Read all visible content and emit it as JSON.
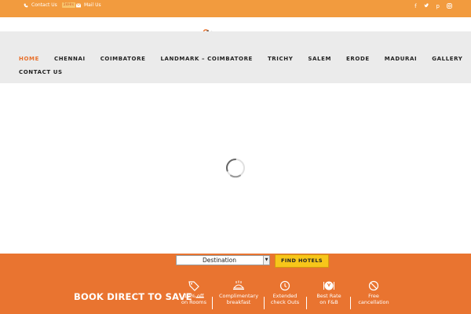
{
  "topbar": {
    "contact_label": "Contact Us",
    "contact_badge": "24Hrs",
    "mail_label": "Mail Us",
    "social_icons": [
      "facebook-icon",
      "twitter-icon",
      "pinterest-icon",
      "instagram-icon"
    ]
  },
  "nav": {
    "items": [
      "HOME",
      "CHENNAI",
      "COIMBATORE",
      "LANDMARK – COIMBATORE",
      "TRICHY",
      "SALEM",
      "ERODE",
      "MADURAI",
      "GALLERY"
    ],
    "items_row2": [
      "CONTACT US"
    ]
  },
  "search": {
    "destination_value": "Destination",
    "find_label": "FIND HOTELS"
  },
  "promo": {
    "title": "BOOK DIRECT TO SAVE —",
    "benefits": [
      {
        "line1": "10% off",
        "line2": "on Rooms",
        "icon": "tag-icon"
      },
      {
        "line1": "Complimentary",
        "line2": "breakfast",
        "icon": "breakfast-icon"
      },
      {
        "line1": "Extended",
        "line2": "check Outs",
        "icon": "clock-icon"
      },
      {
        "line1": "Best Rate",
        "line2": "on F&B",
        "icon": "dining-icon"
      },
      {
        "line1": "Free",
        "line2": "cancellation",
        "icon": "no-cancel-icon"
      }
    ]
  },
  "colors": {
    "topbar": "#f29b3e",
    "accent": "#e97430",
    "nav_bg": "#ebebeb",
    "active_nav": "#e8702b",
    "button": "#f7c61a"
  }
}
